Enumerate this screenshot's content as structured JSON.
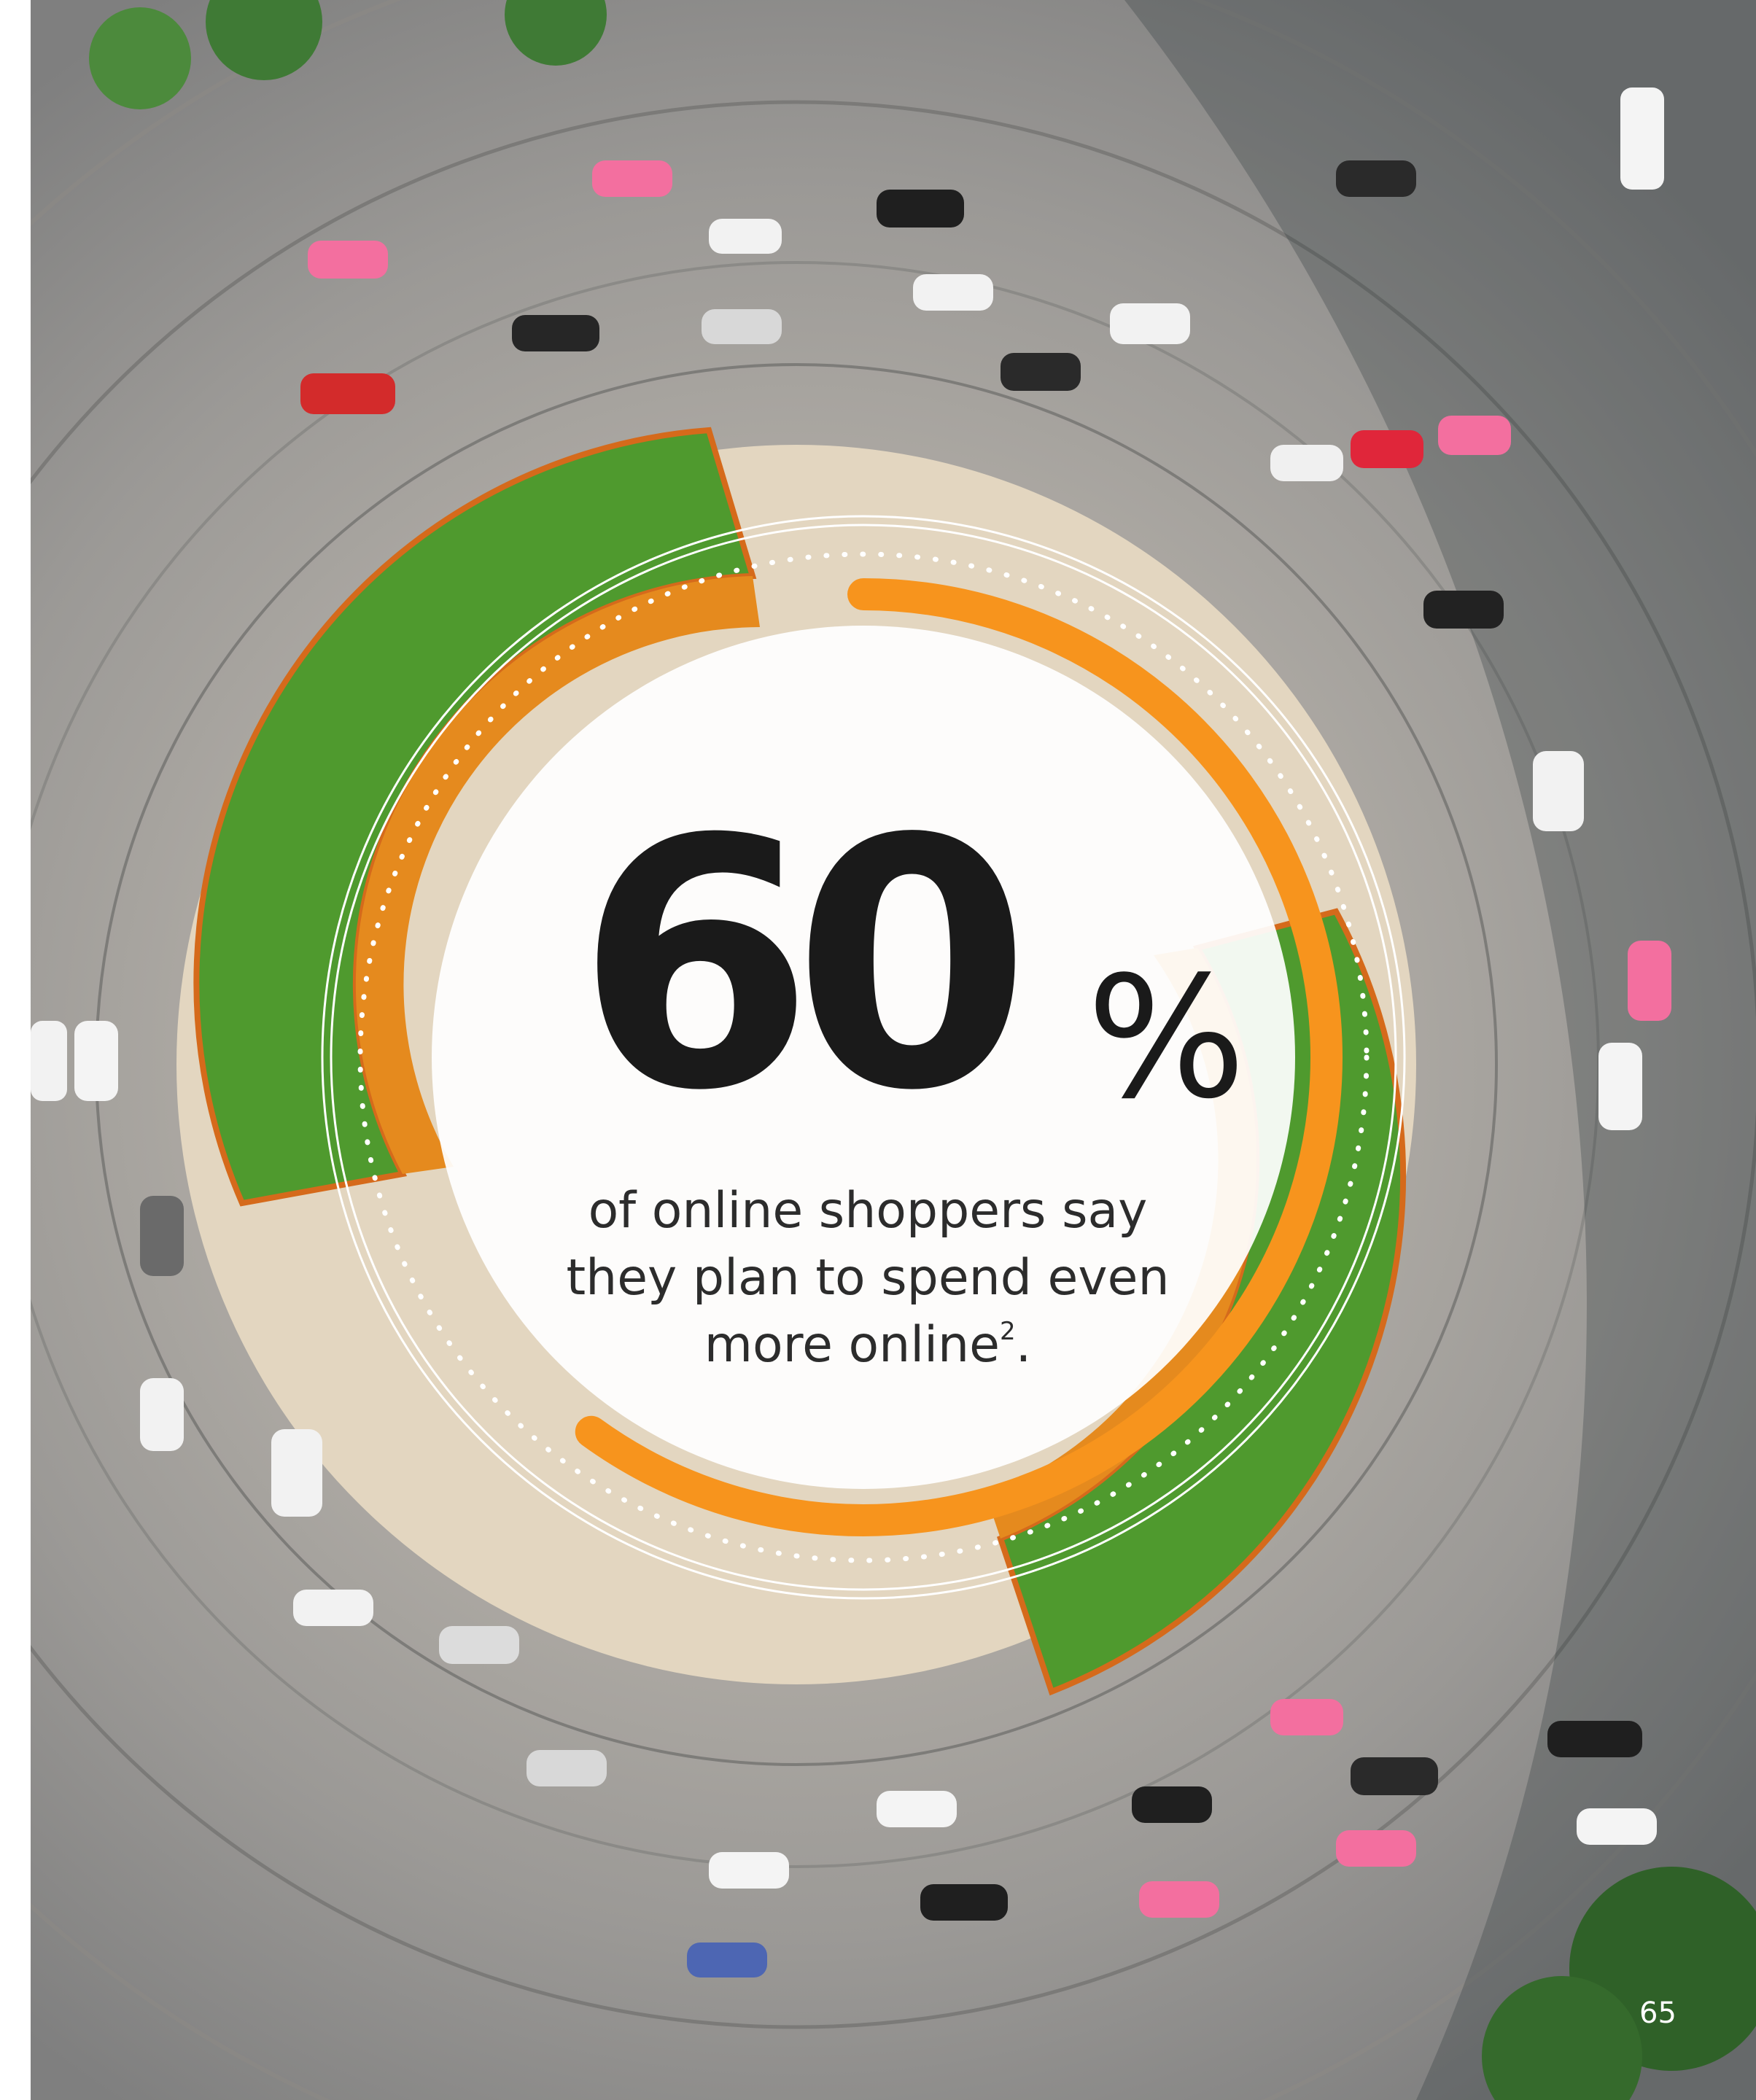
{
  "stat": {
    "number": "60",
    "percent_sign": "%",
    "caption_line1": "of online shoppers say",
    "caption_line2": "they plan to spend even",
    "caption_line3": "more online",
    "footnote_ref": "2",
    "caption_end": "."
  },
  "page_number": "65",
  "progress_ring": {
    "value_percent": 60,
    "color": "#f7941d"
  },
  "photo": {
    "subject": "aerial-roundabout-with-cars"
  }
}
